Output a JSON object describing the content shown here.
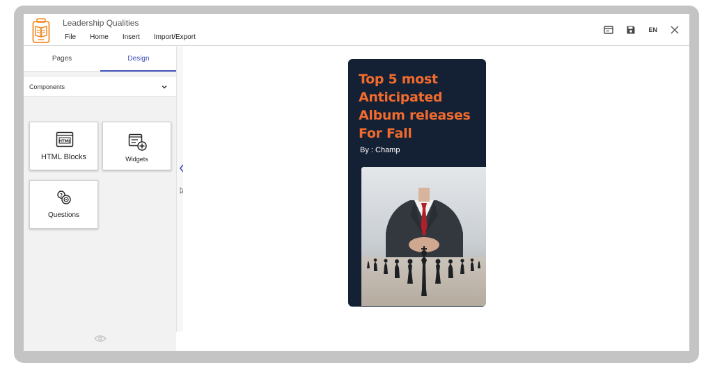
{
  "header": {
    "doc_title": "Leadership Qualities",
    "menu": [
      "File",
      "Home",
      "Insert",
      "Import/Export"
    ],
    "lang": "EN"
  },
  "panel": {
    "tabs": [
      {
        "label": "Pages",
        "active": false
      },
      {
        "label": "Design",
        "active": true
      }
    ],
    "components_label": "Components",
    "cards": [
      {
        "label": "HTML Blocks",
        "icon": "html-icon",
        "icon_text": "HTML"
      },
      {
        "label": "Widgets",
        "icon": "widget-add-icon"
      },
      {
        "label": "Questions",
        "icon": "questions-icon"
      }
    ]
  },
  "story": {
    "title": "Top 5 most Anticipated Album releases For Fall",
    "byline": "By : Champ"
  },
  "colors": {
    "accent": "#3f51b5",
    "story_bg": "#142034",
    "story_title": "#f06b2d",
    "logo": "#f28c28"
  }
}
